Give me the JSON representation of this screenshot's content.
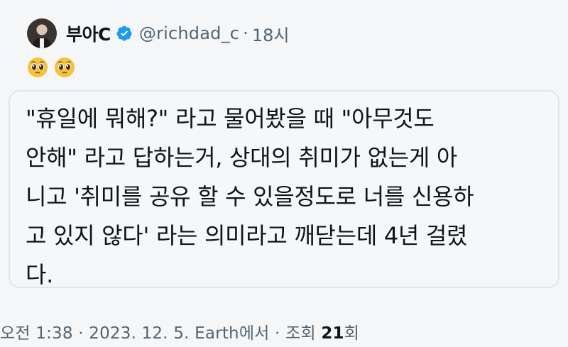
{
  "header": {
    "display_name": "부아C",
    "handle": "@richdad_c",
    "dot": "·",
    "time_ago": "18시"
  },
  "emoji_row": {
    "emoji": [
      "pleading-face",
      "pleading-face"
    ]
  },
  "quote": {
    "text": "\"휴일에 뭐해?\" 라고 물어봤을 때 \"아무것도\n안해\" 라고 답하는거, 상대의 취미가 없는게 아\n니고 '취미를 공유 할 수 있을정도로 너를 신용하\n고 있지 않다' 라는 의미라고 깨닫는데 4년 걸렸\n다."
  },
  "meta": {
    "time": "오전 1:38",
    "sep1": " · ",
    "date": "2023. 12. 5.",
    "source": " Earth에서",
    "sep2": " · ",
    "views_label": "조회 ",
    "views_count": "21",
    "views_suffix": "회"
  },
  "colors": {
    "verified_blue": "#1d9bf0",
    "muted_text": "#536471",
    "border": "#e2e5e8"
  }
}
